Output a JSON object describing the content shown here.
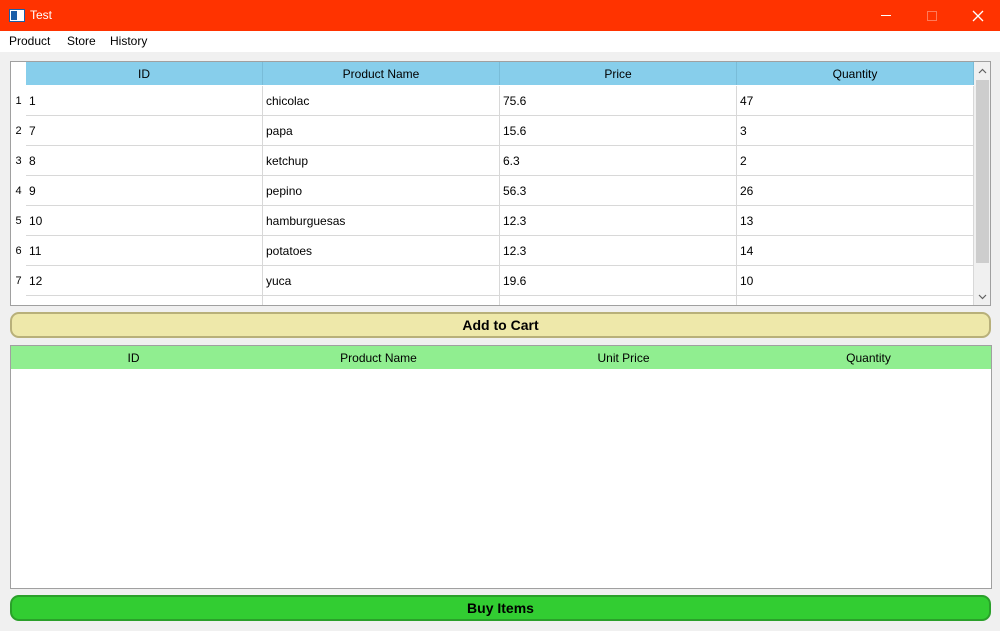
{
  "window": {
    "title": "Test",
    "accent": "#ff3300"
  },
  "menu": [
    "Product",
    "Store",
    "History"
  ],
  "product_table": {
    "header_color": "#87ceeb",
    "columns": [
      "ID",
      "Product Name",
      "Price",
      "Quantity"
    ],
    "rows": [
      {
        "num": "1",
        "cells": [
          "1",
          "chicolac",
          "75.6",
          "47"
        ]
      },
      {
        "num": "2",
        "cells": [
          "7",
          "papa",
          "15.6",
          "3"
        ]
      },
      {
        "num": "3",
        "cells": [
          "8",
          "ketchup",
          "6.3",
          "2"
        ]
      },
      {
        "num": "4",
        "cells": [
          "9",
          "pepino",
          "56.3",
          "26"
        ]
      },
      {
        "num": "5",
        "cells": [
          "10",
          "hamburguesas",
          "12.3",
          "13"
        ]
      },
      {
        "num": "6",
        "cells": [
          "11",
          "potatoes",
          "12.3",
          "14"
        ]
      },
      {
        "num": "7",
        "cells": [
          "12",
          "yuca",
          "19.6",
          "10"
        ]
      }
    ]
  },
  "add_button": {
    "label": "Add to Cart",
    "color": "#eee8aa"
  },
  "cart_table": {
    "header_color": "#90ee90",
    "columns": [
      "ID",
      "Product Name",
      "Unit Price",
      "Quantity"
    ]
  },
  "buy_button": {
    "label": "Buy Items",
    "color": "#32cd32"
  }
}
